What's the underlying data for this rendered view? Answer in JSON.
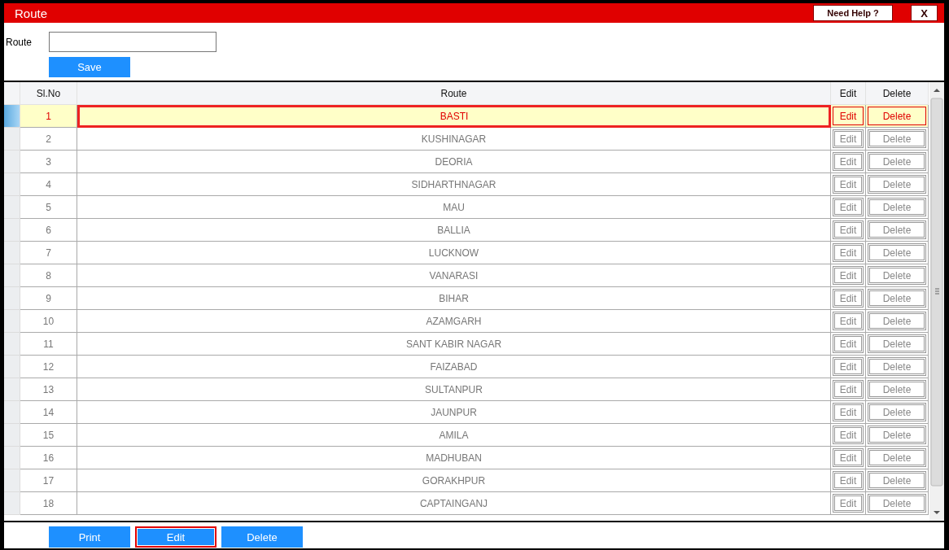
{
  "window": {
    "title": "Route",
    "help_button": "Need Help ?",
    "close_button": "X"
  },
  "form": {
    "label": "Route",
    "save_button": "Save"
  },
  "table": {
    "columns": [
      "Sl.No",
      "Route",
      "Edit",
      "Delete"
    ],
    "rows": [
      {
        "sl_no": "1",
        "route": "BASTI",
        "edit": "Edit",
        "delete": "Delete",
        "selected": true
      },
      {
        "sl_no": "2",
        "route": "KUSHINAGAR",
        "edit": "Edit",
        "delete": "Delete",
        "selected": false
      },
      {
        "sl_no": "3",
        "route": "DEORIA",
        "edit": "Edit",
        "delete": "Delete",
        "selected": false
      },
      {
        "sl_no": "4",
        "route": "SIDHARTHNAGAR",
        "edit": "Edit",
        "delete": "Delete",
        "selected": false
      },
      {
        "sl_no": "5",
        "route": "MAU",
        "edit": "Edit",
        "delete": "Delete",
        "selected": false
      },
      {
        "sl_no": "6",
        "route": "BALLIA",
        "edit": "Edit",
        "delete": "Delete",
        "selected": false
      },
      {
        "sl_no": "7",
        "route": "LUCKNOW",
        "edit": "Edit",
        "delete": "Delete",
        "selected": false
      },
      {
        "sl_no": "8",
        "route": "VANARASI",
        "edit": "Edit",
        "delete": "Delete",
        "selected": false
      },
      {
        "sl_no": "9",
        "route": "BIHAR",
        "edit": "Edit",
        "delete": "Delete",
        "selected": false
      },
      {
        "sl_no": "10",
        "route": "AZAMGARH",
        "edit": "Edit",
        "delete": "Delete",
        "selected": false
      },
      {
        "sl_no": "11",
        "route": "SANT KABIR NAGAR",
        "edit": "Edit",
        "delete": "Delete",
        "selected": false
      },
      {
        "sl_no": "12",
        "route": "FAIZABAD",
        "edit": "Edit",
        "delete": "Delete",
        "selected": false
      },
      {
        "sl_no": "13",
        "route": "SULTANPUR",
        "edit": "Edit",
        "delete": "Delete",
        "selected": false
      },
      {
        "sl_no": "14",
        "route": "JAUNPUR",
        "edit": "Edit",
        "delete": "Delete",
        "selected": false
      },
      {
        "sl_no": "15",
        "route": "AMILA",
        "edit": "Edit",
        "delete": "Delete",
        "selected": false
      },
      {
        "sl_no": "16",
        "route": "MADHUBAN",
        "edit": "Edit",
        "delete": "Delete",
        "selected": false
      },
      {
        "sl_no": "17",
        "route": "GORAKHPUR",
        "edit": "Edit",
        "delete": "Delete",
        "selected": false
      },
      {
        "sl_no": "18",
        "route": "CAPTAINGANJ",
        "edit": "Edit",
        "delete": "Delete",
        "selected": false
      }
    ]
  },
  "actions": [
    {
      "label": "Print",
      "focused": false
    },
    {
      "label": "Edit",
      "focused": true
    },
    {
      "label": "Delete",
      "focused": false
    }
  ]
}
